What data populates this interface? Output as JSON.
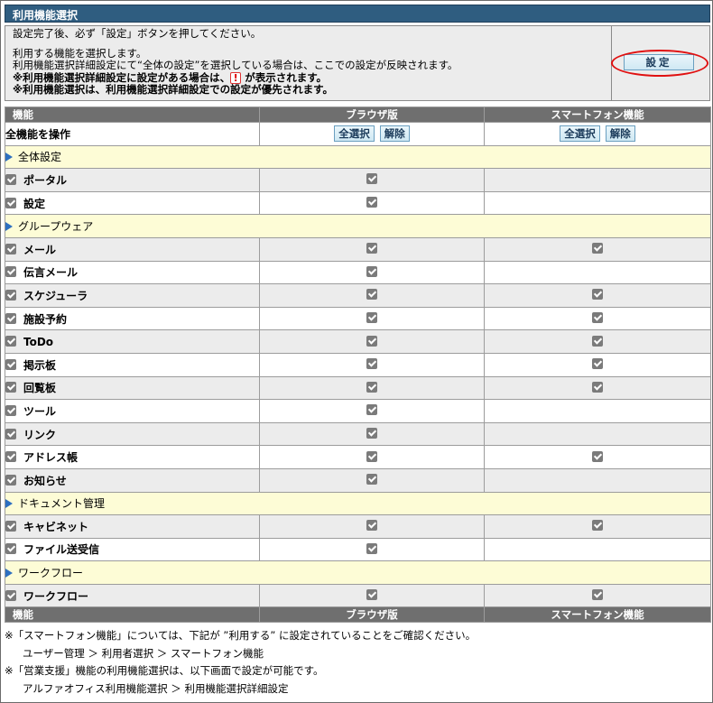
{
  "title": "利用機能選択",
  "info": {
    "line1": "設定完了後、必ず「設定」ボタンを押してください。",
    "line2": "利用する機能を選択します。",
    "line3": "利用機能選択詳細設定にて“全体の設定”を選択している場合は、ここでの設定が反映されます。",
    "line4a": "※利用機能選択詳細設定に設定がある場合は、",
    "excl": "!",
    "line4b": "が表示されます。",
    "line5": "※利用機能選択は、利用機能選択詳細設定での設定が優先されます。"
  },
  "set_button": "設定",
  "columns": [
    "機能",
    "ブラウザ版",
    "スマートフォン機能"
  ],
  "all_ops": {
    "label": "全機能を操作",
    "select_all": "全選択",
    "clear": "解除"
  },
  "sections": [
    {
      "name": "全体設定",
      "items": [
        {
          "label": "ポータル",
          "browser": true,
          "smartphone": false
        },
        {
          "label": "設定",
          "browser": true,
          "smartphone": false
        }
      ]
    },
    {
      "name": "グループウェア",
      "items": [
        {
          "label": "メール",
          "browser": true,
          "smartphone": true
        },
        {
          "label": "伝言メール",
          "browser": true,
          "smartphone": false
        },
        {
          "label": "スケジューラ",
          "browser": true,
          "smartphone": true
        },
        {
          "label": "施設予約",
          "browser": true,
          "smartphone": true
        },
        {
          "label": "ToDo",
          "browser": true,
          "smartphone": true
        },
        {
          "label": "掲示板",
          "browser": true,
          "smartphone": true
        },
        {
          "label": "回覧板",
          "browser": true,
          "smartphone": true
        },
        {
          "label": "ツール",
          "browser": true,
          "smartphone": false
        },
        {
          "label": "リンク",
          "browser": true,
          "smartphone": false
        },
        {
          "label": "アドレス帳",
          "browser": true,
          "smartphone": true
        },
        {
          "label": "お知らせ",
          "browser": true,
          "smartphone": false
        }
      ]
    },
    {
      "name": "ドキュメント管理",
      "items": [
        {
          "label": "キャビネット",
          "browser": true,
          "smartphone": true
        },
        {
          "label": "ファイル送受信",
          "browser": true,
          "smartphone": false
        }
      ]
    },
    {
      "name": "ワークフロー",
      "items": [
        {
          "label": "ワークフロー",
          "browser": true,
          "smartphone": true
        }
      ]
    }
  ],
  "notes": {
    "n1": "※「スマートフォン機能」については、下記が ”利用する” に設定されていることをご確認ください。",
    "n1_path": "ユーザー管理 ＞ 利用者選択 ＞ スマートフォン機能",
    "n2": "※「営業支援」機能の利用機能選択は、以下画面で設定が可能です。",
    "n2_path": "アルファオフィス利用機能選択 ＞ 利用機能選択詳細設定"
  }
}
